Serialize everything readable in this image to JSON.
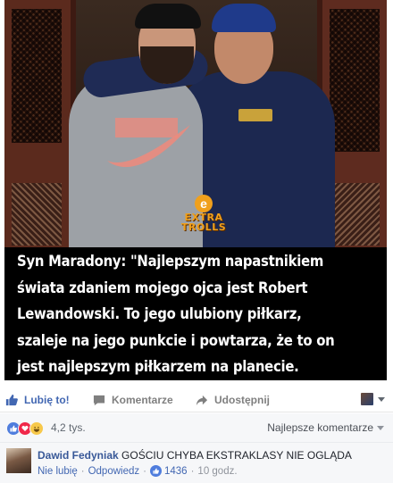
{
  "post": {
    "watermark": {
      "letter": "e",
      "line1": "EXTRA",
      "line2": "TROLLS"
    },
    "caption": "Syn Maradony: \"Najlepszym napastnikiem\nświata zdaniem mojego ojca jest Robert\nLewandowski. To jego ulubiony piłkarz,\nszaleje na jego punkcie i powtarza, że to on\njest najlepszym piłkarzem na planecie."
  },
  "actions": {
    "like": "Lubię to!",
    "comment": "Komentarze",
    "share": "Udostępnij",
    "like_icon": "thumbs-up-icon",
    "comment_icon": "comment-bubble-icon",
    "share_icon": "share-arrow-icon"
  },
  "reactions": {
    "count": "4,2 tys.",
    "types": [
      "like",
      "love",
      "haha"
    ],
    "sort_label": "Najlepsze komentarze"
  },
  "comment": {
    "author": "Dawid Fedyniak",
    "text": "GOŚCIU CHYBA EKSTRAKLASY NIE OGLĄDA",
    "unlike": "Nie lubię",
    "reply": "Odpowiedz",
    "likes": "1436",
    "time": "10 godz."
  },
  "colors": {
    "link_blue": "#4267b2",
    "author_blue": "#385898",
    "meta_gray": "#90949c",
    "bar_bg": "#f6f7f9"
  }
}
